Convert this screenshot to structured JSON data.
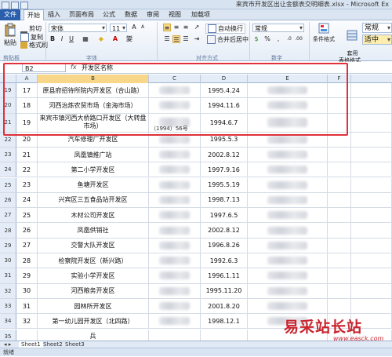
{
  "window": {
    "title": "来宾市开发区出让金额表交明细表.xlsx - Microsoft Ex"
  },
  "tabs": [
    "文件",
    "开始",
    "插入",
    "页面布局",
    "公式",
    "数据",
    "审阅",
    "视图",
    "加载项"
  ],
  "ribbon": {
    "paste": "粘贴",
    "cut": "剪切",
    "copy": "复制",
    "format_painter": "格式刷",
    "font_name": "宋体",
    "font_size": "11",
    "wrap_text": "自动换行",
    "merge_center": "合并后居中",
    "number_format": "常规",
    "conditional_format": "条件格式",
    "table_format": "套用\n表格格式",
    "style_normal": "常规",
    "style_mid": "适中",
    "group_clipboard": "剪贴板",
    "group_font": "字体",
    "group_align": "对齐方式",
    "group_number": "数字"
  },
  "formula_bar": {
    "name_box": "B2",
    "fx": "fx",
    "content": "开发区名称"
  },
  "columns": [
    "A",
    "B",
    "C",
    "D",
    "E",
    "F"
  ],
  "rows": [
    {
      "rownum": "19",
      "a": "17",
      "b": "原县府招待所院内开发区（合山路）",
      "c_extra": "",
      "d": "1995.4.24"
    },
    {
      "rownum": "20",
      "a": "18",
      "b": "河西治炼农贸市场（金海市场）",
      "c_extra": "",
      "d": "1994.11.6"
    },
    {
      "rownum": "21",
      "a": "19",
      "b": "来宾市镇河西大桥路口开发区（大转盘市场）",
      "c_extra": "（1994）56号",
      "d": "1994.6.7"
    },
    {
      "rownum": "22",
      "a": "20",
      "b": "汽车修理厂开发区",
      "c_extra": "",
      "d": "1995.5.3"
    },
    {
      "rownum": "23",
      "a": "21",
      "b": "凤凰镇推广站",
      "c_extra": "",
      "d": "2002.8.12"
    },
    {
      "rownum": "24",
      "a": "22",
      "b": "第二小学开发区",
      "c_extra": "",
      "d": "1997.9.16"
    },
    {
      "rownum": "25",
      "a": "23",
      "b": "鱼塘开发区",
      "c_extra": "",
      "d": "1995.5.19"
    },
    {
      "rownum": "26",
      "a": "24",
      "b": "兴宾区三五食品站开发区",
      "c_extra": "",
      "d": "1998.7.13"
    },
    {
      "rownum": "27",
      "a": "25",
      "b": "木材公司开发区",
      "c_extra": "",
      "d": "1997.6.5"
    },
    {
      "rownum": "28",
      "a": "26",
      "b": "凤凰供销社",
      "c_extra": "",
      "d": "2002.8.12"
    },
    {
      "rownum": "29",
      "a": "27",
      "b": "交警大队开发区",
      "c_extra": "",
      "d": "1996.8.26"
    },
    {
      "rownum": "30",
      "a": "28",
      "b": "检察院开发区（新兴路）",
      "c_extra": "",
      "d": "1992.6.3"
    },
    {
      "rownum": "31",
      "a": "29",
      "b": "实验小学开发区",
      "c_extra": "",
      "d": "1996.1.11"
    },
    {
      "rownum": "32",
      "a": "30",
      "b": "河西粮务开发区",
      "c_extra": "",
      "d": "1995.11.20"
    },
    {
      "rownum": "33",
      "a": "31",
      "b": "园林所开发区",
      "c_extra": "",
      "d": "2001.8.20"
    },
    {
      "rownum": "34",
      "a": "32",
      "b": "第一幼儿园开发区（北四路）",
      "c_extra": "",
      "d": "1998.12.1"
    },
    {
      "rownum": "35",
      "a": "",
      "b": "兵",
      "c_extra": "",
      "d": ""
    }
  ],
  "sheets": [
    "Sheet1",
    "Sheet2",
    "Sheet3"
  ],
  "status": "就绪",
  "watermark": {
    "main": "易采站长站",
    "url": "www.easck.com"
  },
  "colors": {
    "accent": "#2a5fae",
    "annotation": "#e0303a",
    "watermark": "#c9242d"
  }
}
